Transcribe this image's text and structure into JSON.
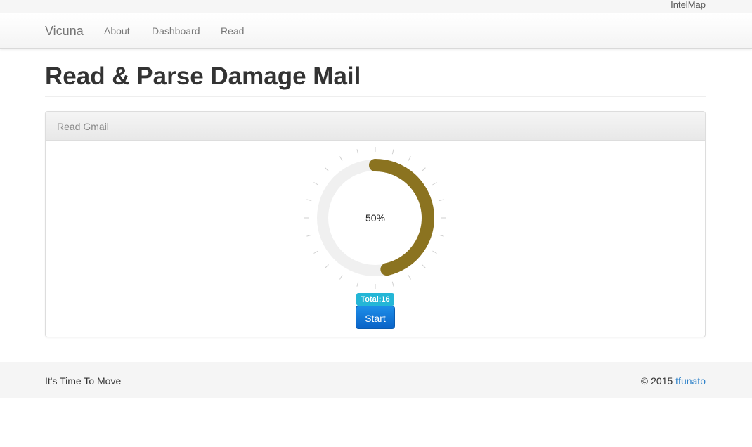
{
  "top_bar": {
    "link_label": "IntelMap"
  },
  "navbar": {
    "brand": "Vicuna",
    "items": [
      {
        "label": "About"
      },
      {
        "label": "Dashboard"
      },
      {
        "label": "Read"
      }
    ]
  },
  "page": {
    "title": "Read & Parse Damage Mail"
  },
  "panel": {
    "title": "Read Gmail",
    "progress": {
      "label": "50%",
      "value": 0.5,
      "track_color": "#f0f0f0",
      "fill_color": "#8b7320",
      "tick_color": "#cfcfcf"
    },
    "total_badge": "Total:16",
    "start_button": "Start",
    "colors": {
      "badge": "#24b6d6",
      "button": "#1379dc"
    }
  },
  "footer": {
    "tagline": "It's Time To Move",
    "copyright_prefix": "© 2015 ",
    "author_link": "tfunato"
  }
}
